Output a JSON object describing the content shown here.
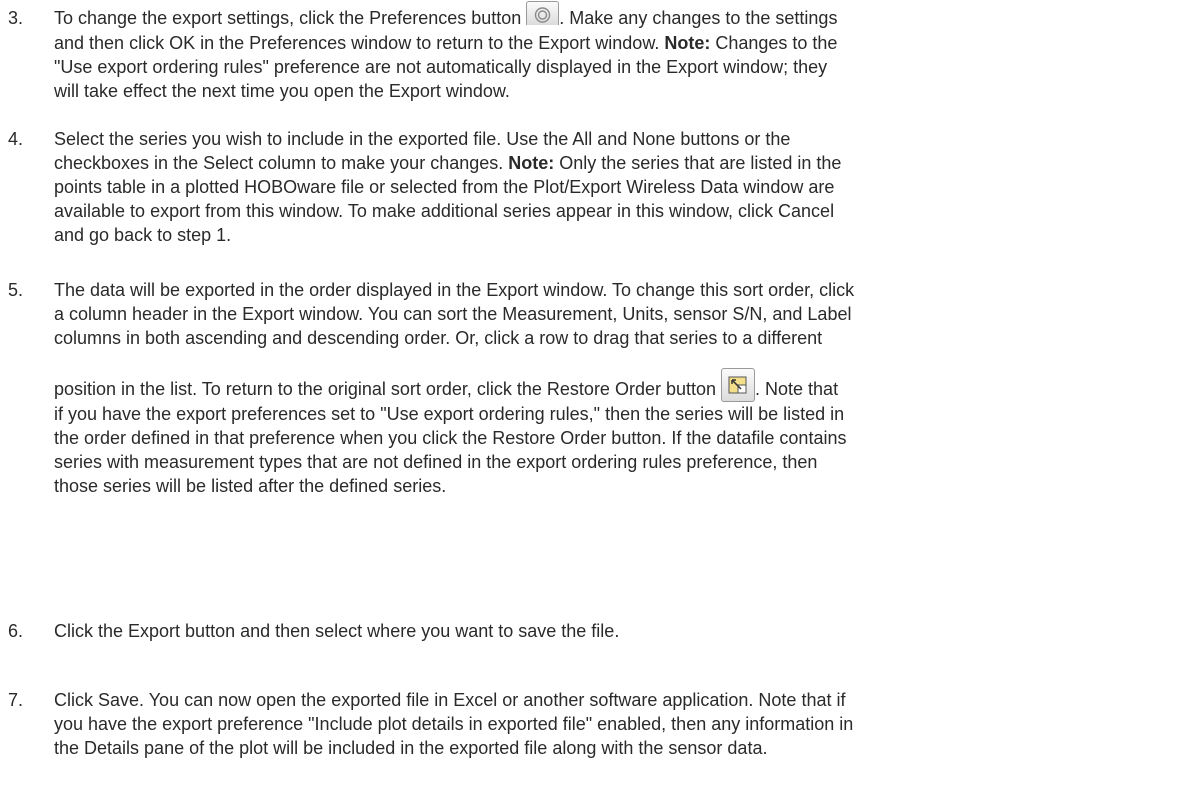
{
  "steps": [
    {
      "number": "3.",
      "lines": [
        [
          "To change the export settings, click the Preferences button ",
          "[preferences-button-icon]",
          ". Make any changes to the settings"
        ],
        [
          "and then click OK in the Preferences window to return to the Export window. ",
          "[Note:]",
          " Changes to the"
        ],
        [
          "\"Use export ordering rules\" preference are not automatically displayed in the Export window; they"
        ],
        [
          "will take effect the next time you open the Export window."
        ]
      ]
    },
    {
      "number": "4.",
      "lines": [
        [
          "Select the series you wish to include in the exported file. Use the All and None buttons or the"
        ],
        [
          "checkboxes in the Select column to make your changes. ",
          "[Note:]",
          " Only the series that are listed in the"
        ],
        [
          "points table in a plotted HOBOware file or selected from the Plot/Export Wireless Data window are"
        ],
        [
          "available to export from this window. To make additional series appear in this window, click Cancel"
        ],
        [
          "and go back to step 1."
        ]
      ]
    },
    {
      "number": "5.",
      "lines": [
        [
          "The data will be exported in the order displayed in the Export window. To change this sort order, click"
        ],
        [
          "a column header in the Export window. You can sort the Measurement, Units, sensor S/N, and Label"
        ],
        [
          "columns in both ascending and descending order. Or, click a row to drag that series to a different"
        ],
        [
          "position in the list. To return to the original sort order, click the Restore Order button ",
          "[restore-order-button-icon]",
          ". Note that"
        ],
        [
          "if you have the export preferences set to \"Use export ordering rules,\" then the series will be listed in"
        ],
        [
          "the order defined in that preference when you click the Restore Order button. If the datafile contains"
        ],
        [
          "series with measurement types that are not defined in the export ordering rules preference, then"
        ],
        [
          "those series will be listed after the defined series."
        ]
      ]
    },
    {
      "number": "6.",
      "lines": [
        [
          "Click the Export button and then select where you want to save the file."
        ]
      ]
    },
    {
      "number": "7.",
      "lines": [
        [
          "Click Save. You can now open the exported file in Excel or another software application. Note that if"
        ],
        [
          "you have the export preference \"Include plot details in exported file\" enabled, then any information in"
        ],
        [
          "the Details pane of the plot will be included in the exported file along with the sensor data."
        ]
      ]
    }
  ],
  "icons": {
    "preferences": "gear-icon",
    "restore_order": "restore-order-icon"
  },
  "note_label": "Note:"
}
